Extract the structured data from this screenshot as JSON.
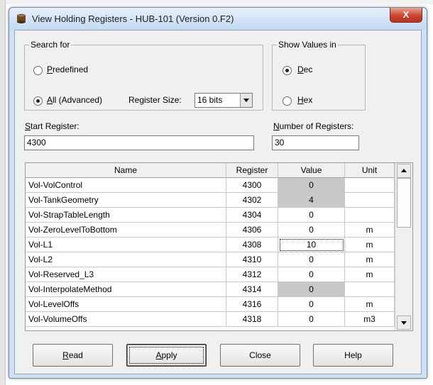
{
  "window": {
    "title": "View Holding Registers - HUB-101 (Version 0.F2)",
    "close_glyph": "X",
    "icon": "app-cylinder-icon"
  },
  "search_for": {
    "legend": "Search for",
    "predefined_label": "Predefined",
    "all_label": "All (Advanced)",
    "selected": "all",
    "register_size_label": "Register Size:",
    "register_size_value": "16 bits"
  },
  "show_values": {
    "legend": "Show Values in",
    "dec_label": "Dec",
    "hex_label": "Hex",
    "selected": "dec"
  },
  "start_register": {
    "label": "Start Register:",
    "value": "4300"
  },
  "number_of_registers": {
    "label": "Number of Registers:",
    "value": "30"
  },
  "table": {
    "columns": [
      "Name",
      "Register",
      "Value",
      "Unit"
    ],
    "rows": [
      {
        "name": "Vol-VolControl",
        "register": "4300",
        "value": "0",
        "unit": "",
        "readonly": true
      },
      {
        "name": "Vol-TankGeometry",
        "register": "4302",
        "value": "4",
        "unit": "",
        "readonly": true
      },
      {
        "name": "Vol-StrapTableLength",
        "register": "4304",
        "value": "0",
        "unit": "",
        "readonly": false
      },
      {
        "name": "Vol-ZeroLevelToBottom",
        "register": "4306",
        "value": "0",
        "unit": "m",
        "readonly": false
      },
      {
        "name": "Vol-L1",
        "register": "4308",
        "value": "10",
        "unit": "m",
        "readonly": false,
        "focused": true
      },
      {
        "name": "Vol-L2",
        "register": "4310",
        "value": "0",
        "unit": "m",
        "readonly": false
      },
      {
        "name": "Vol-Reserved_L3",
        "register": "4312",
        "value": "0",
        "unit": "m",
        "readonly": false
      },
      {
        "name": "Vol-InterpolateMethod",
        "register": "4314",
        "value": "0",
        "unit": "",
        "readonly": true
      },
      {
        "name": "Vol-LevelOffs",
        "register": "4316",
        "value": "0",
        "unit": "m",
        "readonly": false
      },
      {
        "name": "Vol-VolumeOffs",
        "register": "4318",
        "value": "0",
        "unit": "m3",
        "readonly": false
      }
    ]
  },
  "buttons": {
    "read": "Read",
    "apply": "Apply",
    "close": "Close",
    "help": "Help"
  },
  "colors": {
    "readonly_cell": "#c8c8c8",
    "close_button": "#c7452f",
    "titlebar": "#c4d9f0"
  }
}
